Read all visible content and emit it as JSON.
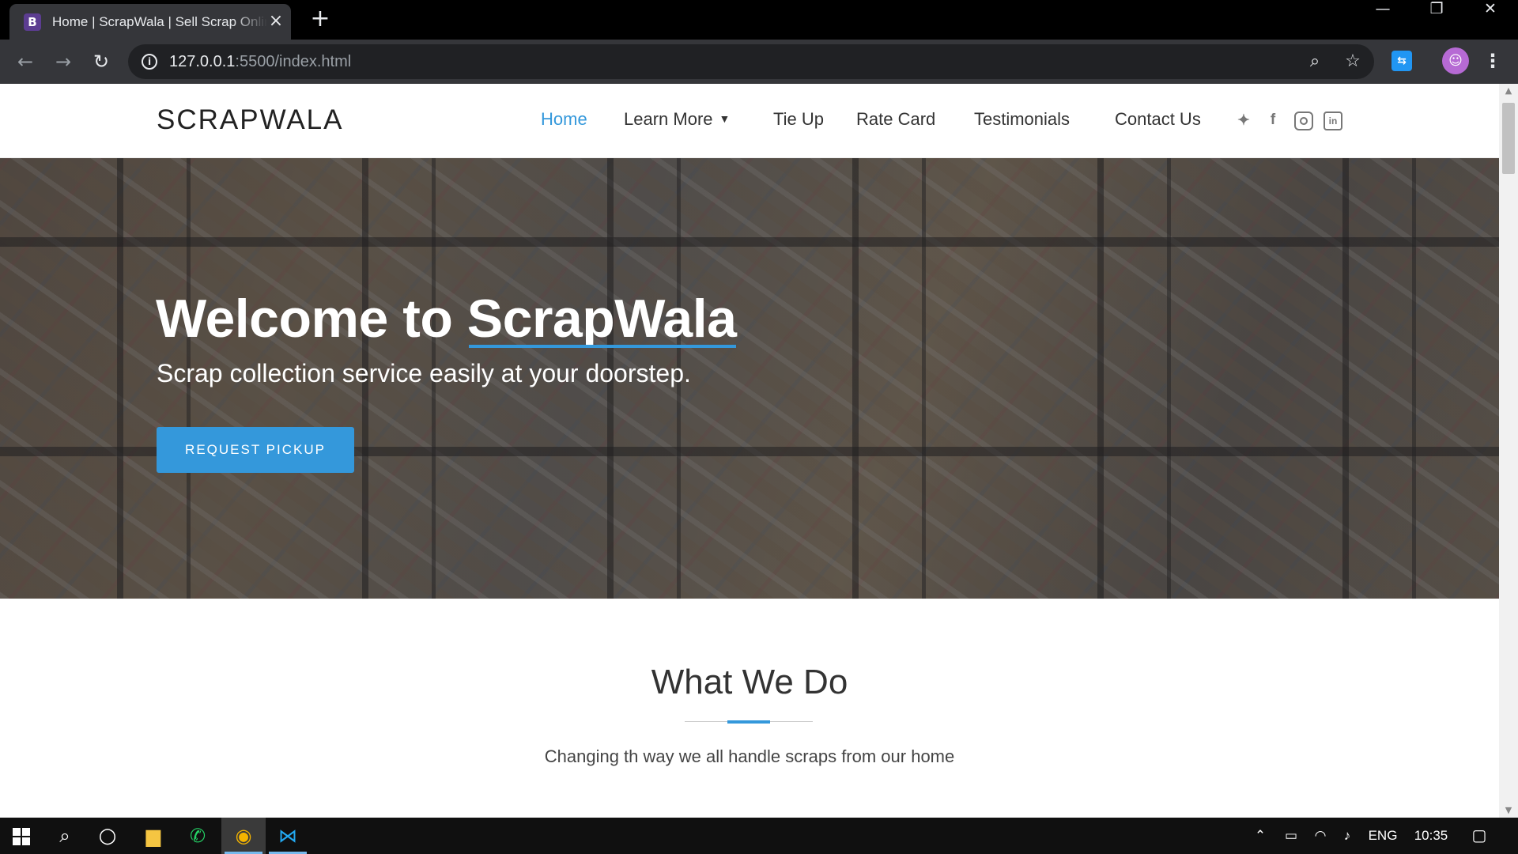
{
  "browser": {
    "tab_favicon": "B",
    "tab_title": "Home | ScrapWala | Sell Scrap Online",
    "url_host": "127.0.0.1",
    "url_rest": ":5500/index.html",
    "icons": [
      "back-icon",
      "forward-icon",
      "reload-icon",
      "zoom-icon",
      "star-icon",
      "extension-icon",
      "profile-avatar",
      "menu-icon"
    ]
  },
  "site": {
    "logo": "SCRAPWALA",
    "nav": [
      {
        "label": "Home",
        "active": true
      },
      {
        "label": "Learn More",
        "dropdown": true
      },
      {
        "label": "Tie Up"
      },
      {
        "label": "Rate Card"
      },
      {
        "label": "Testimonials"
      },
      {
        "label": "Contact Us"
      }
    ],
    "social": [
      "twitter-icon",
      "facebook-icon",
      "instagram-icon",
      "linkedin-icon"
    ],
    "accent_color": "#3498db"
  },
  "hero": {
    "title_prefix": "Welcome to ",
    "title_brand": "ScrapWala",
    "subtitle": "Scrap collection service easily at your doorstep.",
    "cta": "REQUEST PICKUP"
  },
  "what_we_do": {
    "title": "What We Do",
    "subtitle": "Changing th way we all handle scraps from our home"
  },
  "taskbar": {
    "apps": [
      "start-icon",
      "search-icon",
      "cortana-icon",
      "file-explorer-icon",
      "whatsapp-icon",
      "chrome-icon",
      "vscode-icon"
    ],
    "language": "ENG",
    "time": "10:35"
  }
}
